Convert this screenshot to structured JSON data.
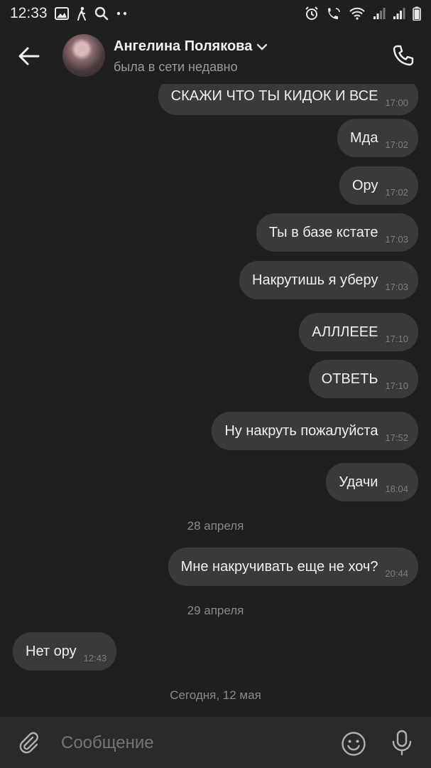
{
  "status_bar": {
    "time": "12:33",
    "left_icons": [
      "image-icon",
      "walk-icon",
      "search-icon",
      "more-dots-icon"
    ],
    "right_icons": [
      "alarm-icon",
      "wifi-call-icon",
      "wifi-icon",
      "signal-icon",
      "signal-icon-2",
      "battery-icon"
    ]
  },
  "header": {
    "contact_name": "Ангелина Полякова",
    "contact_status": "была в сети недавно"
  },
  "messages": [
    {
      "text": "СКАЖИ ЧТО ТЫ КИДОК И ВСЕ",
      "time": "17:00",
      "dir": "out"
    },
    {
      "text": "Мда",
      "time": "17:02",
      "dir": "out"
    },
    {
      "text": "Ору",
      "time": "17:02",
      "dir": "out"
    },
    {
      "text": "Ты в базе кстате",
      "time": "17:03",
      "dir": "out"
    },
    {
      "text": "Накрутишь я уберу",
      "time": "17:03",
      "dir": "out"
    },
    {
      "text": "АЛЛЛЕЕЕ",
      "time": "17:10",
      "dir": "out"
    },
    {
      "text": "ОТВЕТЬ",
      "time": "17:10",
      "dir": "out"
    },
    {
      "text": "Ну накруть пожалуйста",
      "time": "17:52",
      "dir": "out"
    },
    {
      "text": "Удачи",
      "time": "18:04",
      "dir": "out"
    },
    {
      "text": "Мне накручивать еще не хоч?",
      "time": "20:44",
      "dir": "out"
    },
    {
      "text": "Нет ору",
      "time": "12:43",
      "dir": "in"
    }
  ],
  "dates": {
    "d1": "28 апреля",
    "d2": "29 апреля",
    "d3": "Сегодня, 12 мая"
  },
  "composer": {
    "placeholder": "Сообщение"
  },
  "colors": {
    "background": "#1f1f1f",
    "bubble": "#3a3a3c",
    "composer": "#2a2a2c"
  }
}
